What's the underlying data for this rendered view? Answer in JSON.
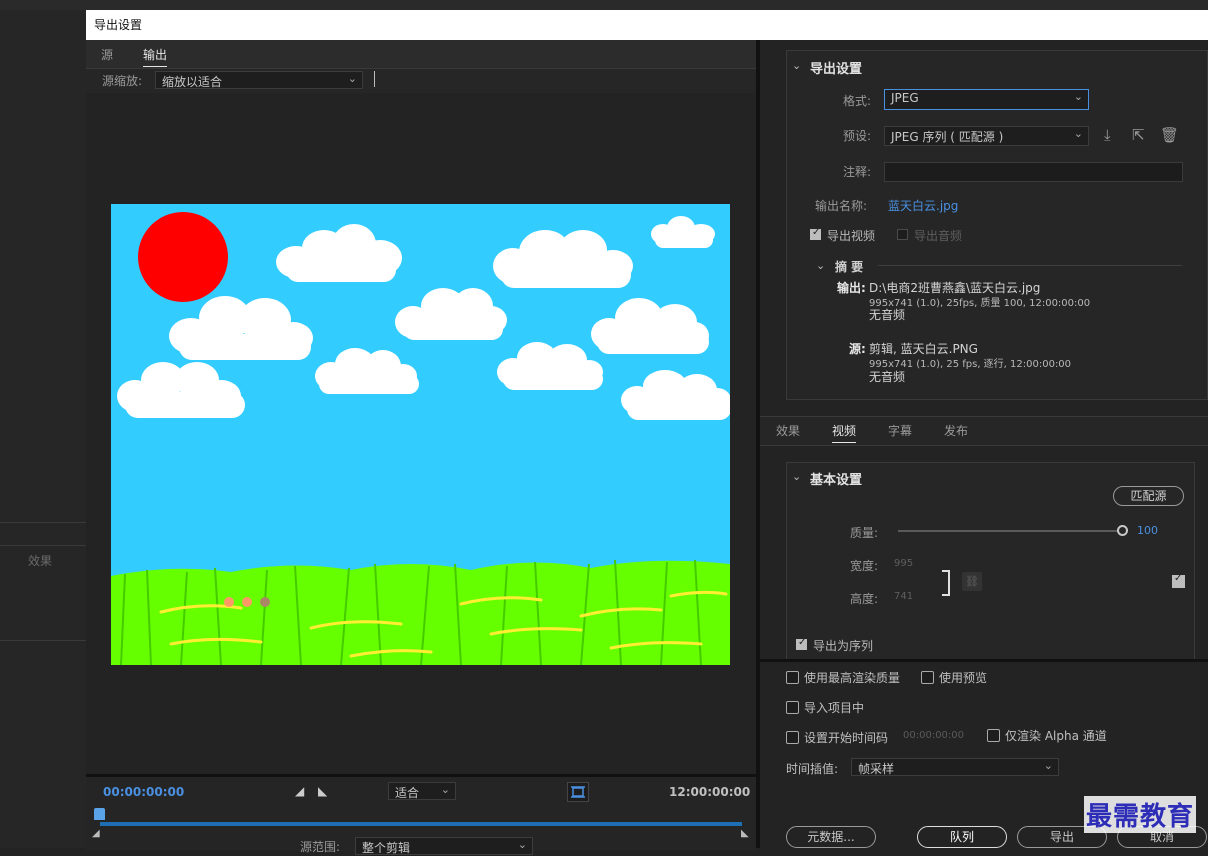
{
  "dialog_title": "导出设置",
  "background": {
    "effects_label": "效果"
  },
  "preview": {
    "tabs": [
      "源",
      "输出"
    ],
    "active_tab": "输出",
    "zoom_label": "源缩放:",
    "zoom_value": "缩放以适合"
  },
  "timeline": {
    "start_tc": "00:00:00:00",
    "end_tc": "12:00:00:00",
    "fit_value": "适合",
    "source_range_label": "源范围:",
    "source_range_value": "整个剪辑"
  },
  "export_settings": {
    "header": "导出设置",
    "format_label": "格式:",
    "format_value": "JPEG",
    "preset_label": "预设:",
    "preset_value": "JPEG 序列 ( 匹配源 )",
    "comment_label": "注释:",
    "comment_value": "",
    "output_name_label": "输出名称:",
    "output_name": "蓝天白云.jpg",
    "export_video_label": "导出视频",
    "export_video_checked": true,
    "export_audio_label": "导出音频",
    "export_audio_checked": false,
    "summary": {
      "header": "摘 要",
      "output_key": "输出:",
      "output_path": "D:\\电商2班曹燕鑫\\蓝天白云.jpg",
      "output_detail": "995x741 (1.0), 25fps, 质量 100, 12:00:00:00",
      "output_audio": "无音频",
      "source_key": "源:",
      "source_name": "剪辑, 蓝天白云.PNG",
      "source_detail": "995x741 (1.0), 25 fps, 逐行, 12:00:00:00",
      "source_audio": "无音频"
    }
  },
  "settings_tabs": [
    "效果",
    "视频",
    "字幕",
    "发布"
  ],
  "active_settings_tab": "视频",
  "basic_settings": {
    "header": "基本设置",
    "match_source_label": "匹配源",
    "quality_label": "质量:",
    "quality_value": "100",
    "quality_fraction": 1.0,
    "width_label": "宽度:",
    "width_value": "995",
    "height_label": "高度:",
    "height_value": "741",
    "export_sequence_label": "导出为序列",
    "export_sequence_checked": true
  },
  "bottom_options": {
    "max_render_quality": "使用最高渲染质量",
    "use_previews": "使用预览",
    "import_into_project": "导入项目中",
    "set_start_timecode": "设置开始时间码",
    "start_timecode_value": "00:00:00:00",
    "render_alpha_only": "仅渲染 Alpha 通道",
    "time_interpolation_label": "时间插值:",
    "time_interpolation_value": "帧采样"
  },
  "buttons": {
    "metadata": "元数据...",
    "queue": "队列",
    "export": "导出",
    "cancel": "取消"
  },
  "watermark": "最需教育",
  "colors": {
    "accent": "#4a90e2",
    "sky": "#33ccff",
    "sun": "#ff0000",
    "grass": "#66ff00"
  }
}
